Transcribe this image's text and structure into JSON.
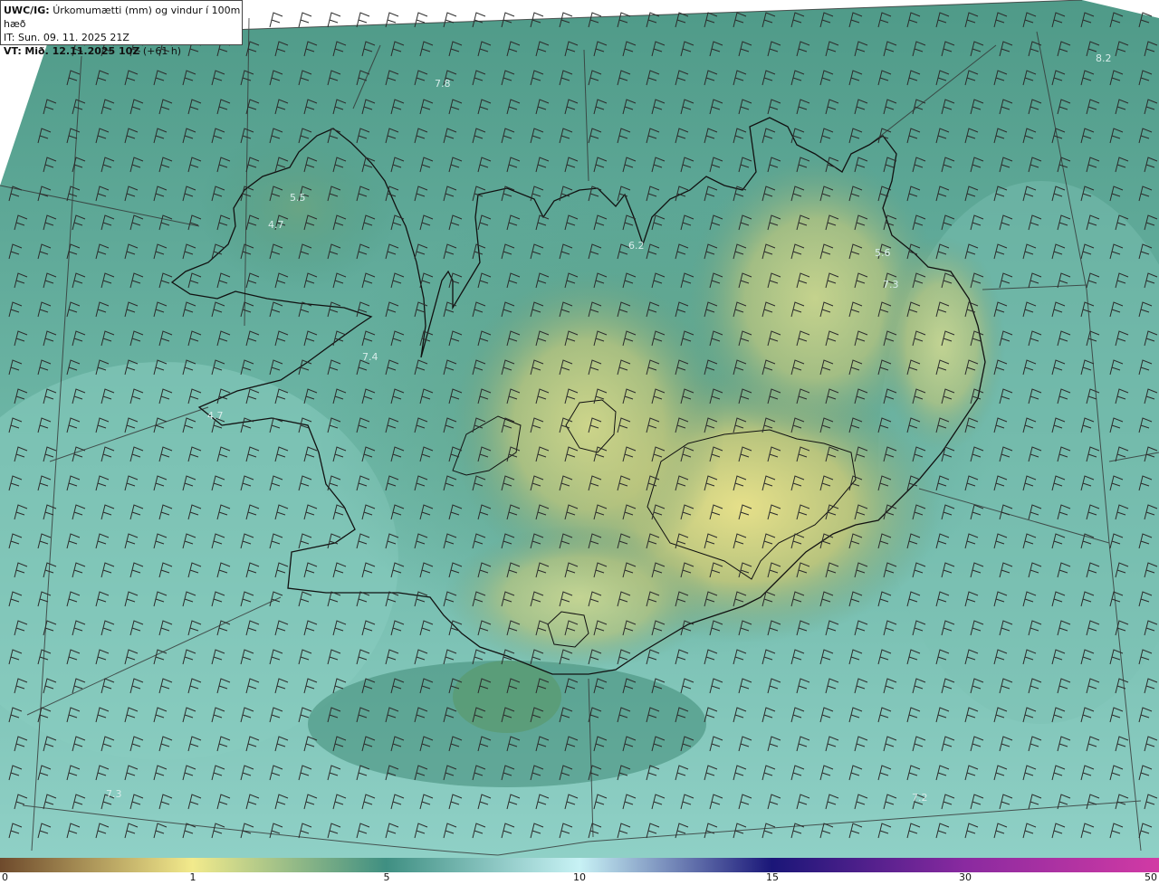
{
  "header": {
    "product_code": "UWC/IG:",
    "product_title": "Úrkomumætti (mm) og vindur í 100m hæð",
    "init_time": "IT: Sun. 09. 11. 2025 21Z",
    "valid_prefix": "VT:",
    "valid_time_bold": "Mið. 12.11.2025 10Z",
    "valid_offset": "(+61 h)"
  },
  "map": {
    "region": "Iceland",
    "field": "precipitable water",
    "value_labels": [
      "7.8",
      "8.2",
      "5.5",
      "4.7",
      "6.2",
      "5.6",
      "7.3",
      "7.4",
      "4.7",
      "7.3",
      "7.2"
    ]
  },
  "colorbar": {
    "ticks": [
      "0",
      "1",
      "5",
      "10",
      "15",
      "30",
      "50"
    ],
    "colors": {
      "brown": "#6e4a2c",
      "yellow": "#f2ea8c",
      "teal": "#3f8f82",
      "pale_cyan": "#c8f2f5",
      "navy": "#1a1678",
      "purple": "#8a2aa0",
      "magenta": "#d23aa4"
    }
  }
}
